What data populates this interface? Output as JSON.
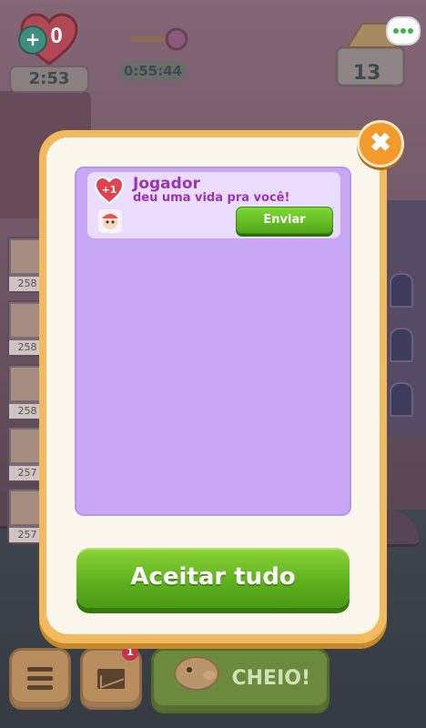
{
  "hud": {
    "lives_count": "0",
    "lives_timer": "2:53",
    "key_timer": "0:55:44",
    "gold_count": "13"
  },
  "leaderboard": [
    "258",
    "258",
    "258",
    "257",
    "257"
  ],
  "bottom_bar": {
    "mail_badge": "1",
    "full_label": "CHEIO!"
  },
  "dialog": {
    "close_label": "✖",
    "message": {
      "life_badge": "+1",
      "sender": "Jogador",
      "text": "deu uma vida pra você!",
      "send_label": "Enviar"
    },
    "accept_all_label": "Aceitar tudo"
  },
  "colors": {
    "accent_green": "#5fb21f",
    "modal_orange": "#f3ba5d",
    "list_purple": "#c8a8f5",
    "title_purple": "#9b33b7"
  }
}
